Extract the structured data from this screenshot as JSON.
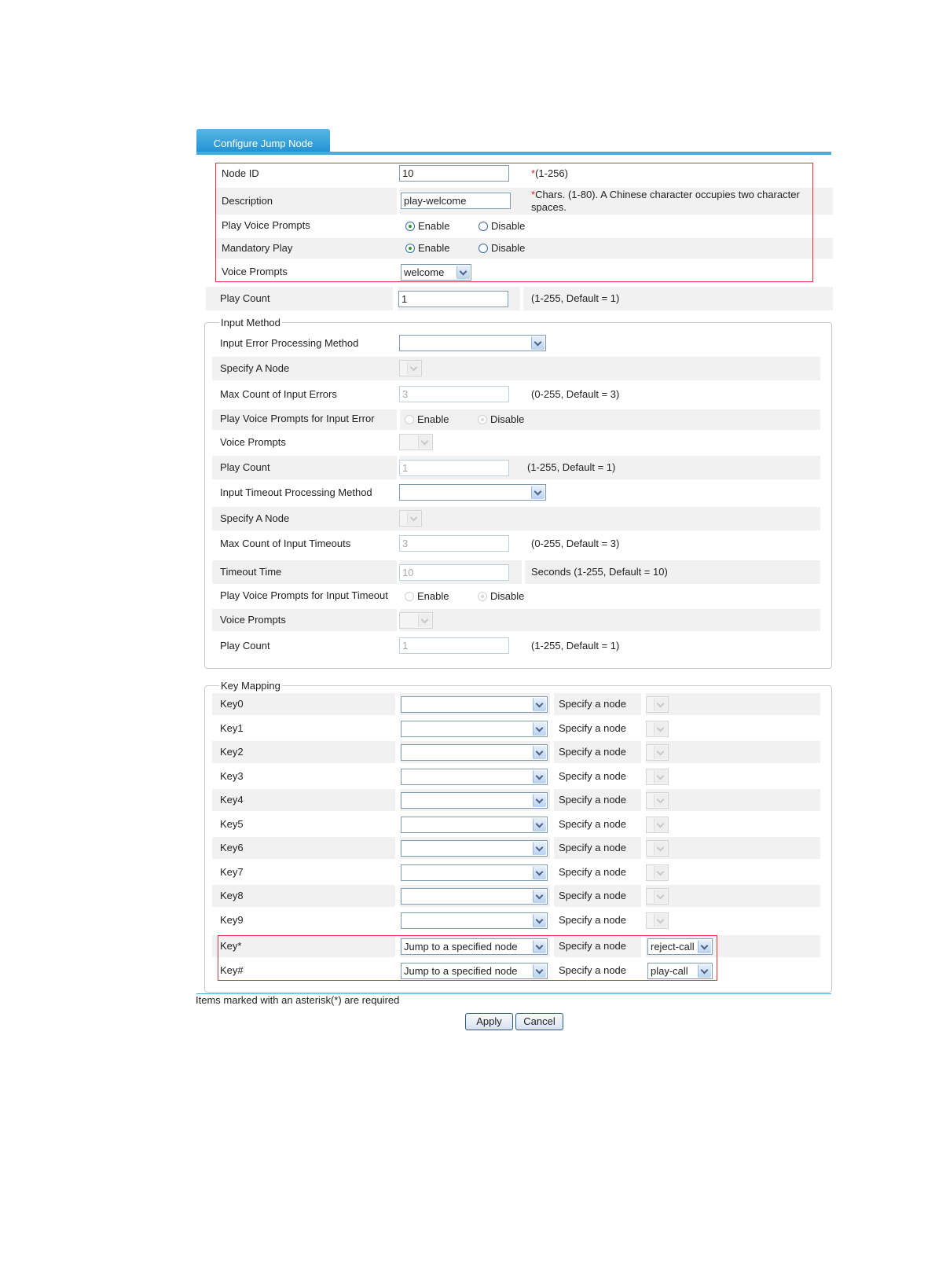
{
  "tab": {
    "title": "Configure Jump Node"
  },
  "basic": {
    "node_id": {
      "label": "Node ID",
      "value": "10",
      "hint_star": "*",
      "hint": "(1-256)"
    },
    "description": {
      "label": "Description",
      "value": "play-welcome",
      "hint_star": "*",
      "hint_line1": "Chars. (1-80). A Chinese character occupies two character",
      "hint_line2": "spaces."
    },
    "play_voice_prompts": {
      "label": "Play Voice Prompts",
      "enable": "Enable",
      "disable": "Disable",
      "selected": "Enable"
    },
    "mandatory_play": {
      "label": "Mandatory Play",
      "enable": "Enable",
      "disable": "Disable",
      "selected": "Enable"
    },
    "voice_prompts": {
      "label": "Voice Prompts",
      "value": "welcome"
    },
    "play_count": {
      "label": "Play Count",
      "value": "1",
      "hint": "(1-255, Default = 1)"
    }
  },
  "input_method": {
    "legend": "Input Method",
    "error_method": {
      "label": "Input Error Processing Method",
      "value": ""
    },
    "error_node": {
      "label": "Specify A Node"
    },
    "max_errors": {
      "label": "Max Count of Input Errors",
      "value": "3",
      "hint": "(0-255, Default = 3)"
    },
    "error_prompts": {
      "label": "Play Voice Prompts for Input Error",
      "enable": "Enable",
      "disable": "Disable",
      "selected": "Disable"
    },
    "error_voice": {
      "label": "Voice Prompts"
    },
    "error_count": {
      "label": "Play Count",
      "value": "1",
      "hint": "(1-255, Default = 1)"
    },
    "timeout_method": {
      "label": "Input Timeout Processing Method",
      "value": ""
    },
    "timeout_node": {
      "label": "Specify A Node"
    },
    "max_timeouts": {
      "label": "Max Count of Input Timeouts",
      "value": "3",
      "hint": "(0-255, Default = 3)"
    },
    "timeout_time": {
      "label": "Timeout Time",
      "value": "10",
      "hint": "Seconds (1-255, Default = 10)"
    },
    "timeout_prompts": {
      "label": "Play Voice Prompts for Input Timeout",
      "enable": "Enable",
      "disable": "Disable",
      "selected": "Disable"
    },
    "timeout_voice": {
      "label": "Voice Prompts"
    },
    "timeout_count": {
      "label": "Play Count",
      "value": "1",
      "hint": "(1-255, Default = 1)"
    }
  },
  "key_mapping": {
    "legend": "Key Mapping",
    "specify_label": "Specify a node",
    "keys": [
      {
        "key": "Key0",
        "action": "",
        "node": ""
      },
      {
        "key": "Key1",
        "action": "",
        "node": ""
      },
      {
        "key": "Key2",
        "action": "",
        "node": ""
      },
      {
        "key": "Key3",
        "action": "",
        "node": ""
      },
      {
        "key": "Key4",
        "action": "",
        "node": ""
      },
      {
        "key": "Key5",
        "action": "",
        "node": ""
      },
      {
        "key": "Key6",
        "action": "",
        "node": ""
      },
      {
        "key": "Key7",
        "action": "",
        "node": ""
      },
      {
        "key": "Key8",
        "action": "",
        "node": ""
      },
      {
        "key": "Key9",
        "action": "",
        "node": ""
      },
      {
        "key": "Key*",
        "action": "Jump to a specified node",
        "node": "reject-call"
      },
      {
        "key": "Key#",
        "action": "Jump to a specified node",
        "node": "play-call"
      }
    ]
  },
  "footer": {
    "required_note": "Items marked with an asterisk(*) are required",
    "apply": "Apply",
    "cancel": "Cancel"
  }
}
